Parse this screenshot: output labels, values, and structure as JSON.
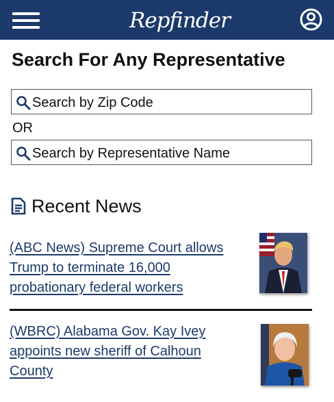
{
  "header": {
    "brand": "Repfinder",
    "menu_icon": "hamburger-menu-icon",
    "account_icon": "account-circle-icon",
    "bg_color": "#1b3a6b"
  },
  "search": {
    "title": "Search For Any Representative",
    "zip_placeholder": "Search by Zip Code",
    "or_label": "OR",
    "name_placeholder": "Search by Representative Name",
    "icon": "search-icon"
  },
  "news": {
    "heading": "Recent News",
    "heading_icon": "article-icon",
    "items": [
      {
        "title": "(ABC News) Supreme Court allows Trump to terminate 16,000 probationary federal workers"
      },
      {
        "title": "(WBRC) Alabama Gov. Kay Ivey appoints new sheriff of Calhoun County"
      }
    ]
  }
}
